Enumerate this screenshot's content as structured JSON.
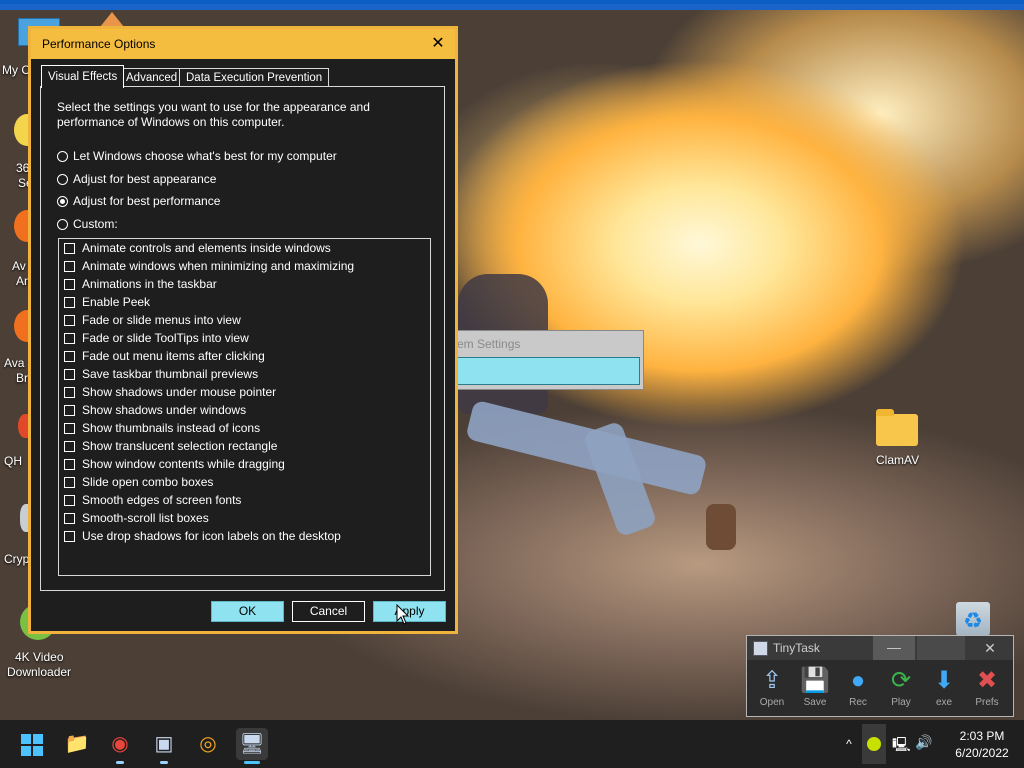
{
  "desktop": {
    "icons": [
      {
        "label": "My C",
        "icon": "computer-icon"
      },
      {
        "label": "36",
        "sub": "Se",
        "icon": "360-security-icon"
      },
      {
        "label": "Av",
        "sub": "An",
        "icon": "avast-icon"
      },
      {
        "label": "Ava",
        "sub": "Br",
        "icon": "avast-browser-icon"
      },
      {
        "label": "QH",
        "icon": "qh-icon"
      },
      {
        "label": "Cryp",
        "icon": "crypto-icon"
      },
      {
        "label": "4K Video",
        "sub": "Downloader",
        "icon": "4k-video-downloader-icon"
      },
      {
        "label": "ClamAV",
        "icon": "folder-icon"
      },
      {
        "label": "",
        "icon": "recycle-bin-icon"
      }
    ]
  },
  "background_window": {
    "title": "em Settings"
  },
  "dialog": {
    "title": "Performance Options",
    "close_glyph": "✕",
    "tabs": [
      {
        "label": "Visual Effects",
        "active": true
      },
      {
        "label": "Advanced",
        "active": false
      },
      {
        "label": "Data Execution Prevention",
        "active": false
      }
    ],
    "description": "Select the settings you want to use for the appearance and performance of Windows on this computer.",
    "radios": [
      {
        "label": "Let Windows choose what's best for my computer",
        "checked": false
      },
      {
        "label": "Adjust for best appearance",
        "checked": false
      },
      {
        "label": "Adjust for best performance",
        "checked": true
      },
      {
        "label": "Custom:",
        "checked": false
      }
    ],
    "effects": [
      {
        "label": "Animate controls and elements inside windows",
        "checked": false
      },
      {
        "label": "Animate windows when minimizing and maximizing",
        "checked": false
      },
      {
        "label": "Animations in the taskbar",
        "checked": false
      },
      {
        "label": "Enable Peek",
        "checked": false
      },
      {
        "label": "Fade or slide menus into view",
        "checked": false
      },
      {
        "label": "Fade or slide ToolTips into view",
        "checked": false
      },
      {
        "label": "Fade out menu items after clicking",
        "checked": false
      },
      {
        "label": "Save taskbar thumbnail previews",
        "checked": false
      },
      {
        "label": "Show shadows under mouse pointer",
        "checked": false
      },
      {
        "label": "Show shadows under windows",
        "checked": false
      },
      {
        "label": "Show thumbnails instead of icons",
        "checked": false
      },
      {
        "label": "Show translucent selection rectangle",
        "checked": false
      },
      {
        "label": "Show window contents while dragging",
        "checked": false
      },
      {
        "label": "Slide open combo boxes",
        "checked": false
      },
      {
        "label": "Smooth edges of screen fonts",
        "checked": false
      },
      {
        "label": "Smooth-scroll list boxes",
        "checked": false
      },
      {
        "label": "Use drop shadows for icon labels on the desktop",
        "checked": false
      }
    ],
    "buttons": {
      "ok": "OK",
      "cancel": "Cancel",
      "apply": "Apply"
    }
  },
  "tinytask": {
    "title": "TinyTask",
    "min_glyph": "—",
    "close_glyph": "✕",
    "buttons": [
      {
        "label": "Open",
        "icon": "open-icon",
        "glyph": "⇪",
        "color": "#9fc9ef"
      },
      {
        "label": "Save",
        "icon": "save-icon",
        "glyph": "💾",
        "color": "#d8d8d8"
      },
      {
        "label": "Rec",
        "icon": "record-icon",
        "glyph": "●",
        "color": "#3fa9f5"
      },
      {
        "label": "Play",
        "icon": "play-icon",
        "glyph": "⟳",
        "color": "#39b54a"
      },
      {
        "label": "exe",
        "icon": "compile-icon",
        "glyph": "⬇",
        "color": "#3fa9f5"
      },
      {
        "label": "Prefs",
        "icon": "prefs-icon",
        "glyph": "✖",
        "color": "#e05050"
      }
    ]
  },
  "taskbar": {
    "items": [
      {
        "name": "file-explorer-icon",
        "glyph": "📁",
        "color": "#f7c64a"
      },
      {
        "name": "chrome-icon",
        "glyph": "◉",
        "color": "#e8453c",
        "running": true
      },
      {
        "name": "system-settings-app-icon",
        "glyph": "▣",
        "color": "#c8d8ee",
        "running": true
      },
      {
        "name": "avast-secure-browser-icon",
        "glyph": "◎",
        "color": "#f5a623"
      },
      {
        "name": "performance-options-app-icon",
        "glyph": "🖥",
        "color": "#c8d8ee",
        "active": true
      }
    ],
    "tray": {
      "chevron": "^",
      "network_glyph": "🖳",
      "volume_glyph": "🔊"
    },
    "clock": {
      "time": "2:03 PM",
      "date": "6/20/2022"
    }
  }
}
